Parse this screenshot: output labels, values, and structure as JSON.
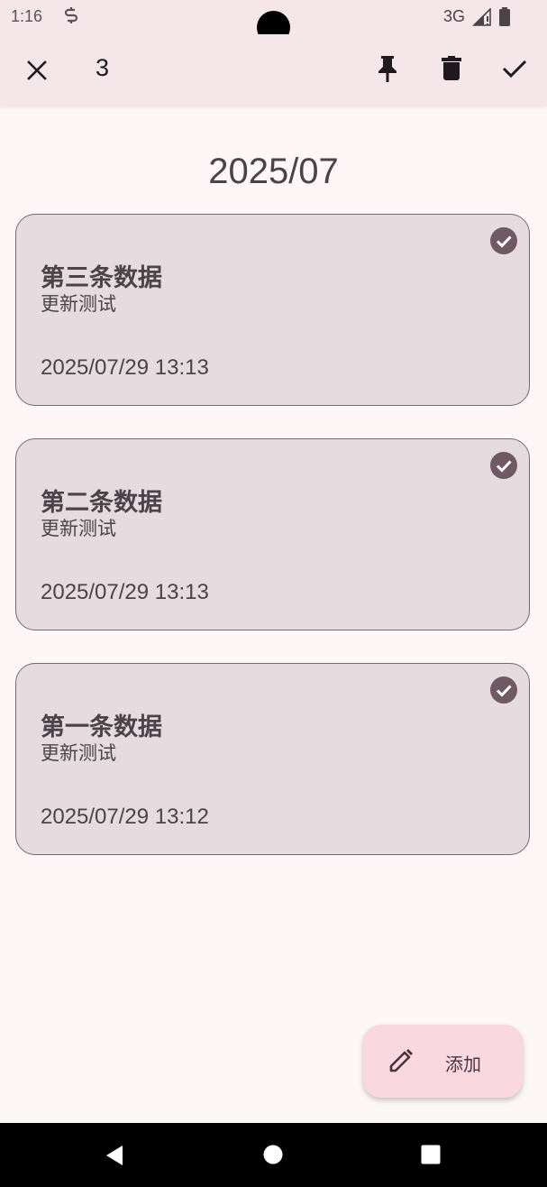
{
  "status_bar": {
    "time": "1:16",
    "network": "3G",
    "icons": [
      "sync-icon",
      "signal-icon",
      "battery-icon"
    ]
  },
  "action_bar": {
    "selected_count": "3",
    "icons": [
      "close-icon",
      "pin-icon",
      "delete-icon",
      "check-icon"
    ]
  },
  "month_header": "2025/07",
  "notes": [
    {
      "title": "第三条数据",
      "subtitle": "更新测试",
      "date": "2025/07/29 13:13",
      "selected": true
    },
    {
      "title": "第二条数据",
      "subtitle": "更新测试",
      "date": "2025/07/29 13:13",
      "selected": true
    },
    {
      "title": "第一条数据",
      "subtitle": "更新测试",
      "date": "2025/07/29 13:12",
      "selected": true
    }
  ],
  "fab": {
    "label": "添加",
    "icon": "pencil-icon"
  },
  "nav_bar": {
    "icons": [
      "back-icon",
      "home-icon",
      "recents-icon"
    ]
  },
  "colors": {
    "background": "#fdf7f7",
    "top_bar": "#f5e6ea",
    "card_background": "#e6dcdf",
    "card_border": "#7a6670",
    "accent": "#7d5260",
    "fab_background": "#fad8df"
  }
}
